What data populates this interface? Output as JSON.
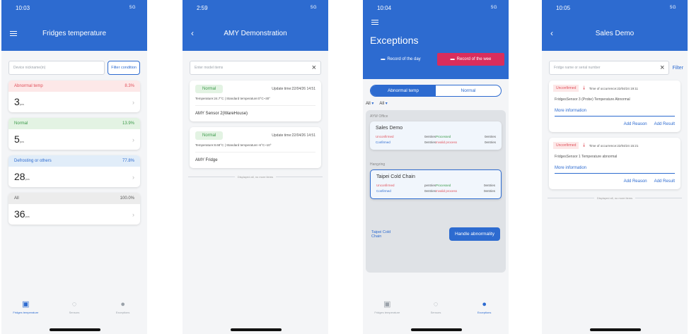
{
  "colors": {
    "primary": "#2d6bd0",
    "abnormal": "#fde8e8",
    "normal": "#e3f3e3",
    "defrost": "#e1edf9",
    "all": "#ececec"
  },
  "screen1": {
    "time": "10:03",
    "signal": "5G",
    "title": "Fridges temperature",
    "search_placeholder": "Device nickname(in)",
    "filter_button": "Filter condition",
    "stats": [
      {
        "label": "Abnormal temp",
        "pct": "8.3%",
        "count": "3",
        "unit": "pcs"
      },
      {
        "label": "Normal",
        "pct": "13.9%",
        "count": "5",
        "unit": "pcs"
      },
      {
        "label": "Defrosting or others",
        "pct": "77.8%",
        "count": "28",
        "unit": "pcs"
      },
      {
        "label": "All",
        "pct": "100.0%",
        "count": "36",
        "unit": "pcs"
      }
    ],
    "tabs": [
      "Fridges temperature",
      "Sensors",
      "Exceptions"
    ]
  },
  "screen2": {
    "time": "2:59",
    "signal": "5G",
    "title": "AMY Demonstration",
    "search_placeholder": "Enter model items",
    "devices": [
      {
        "status": "Normal",
        "update": "Update time:22/04/26 14:51",
        "temp": "Temperature:24.7°C | Standard temperature:0°C~30°",
        "name": "AMY Sensor 2(WareHouse)"
      },
      {
        "status": "Normal",
        "update": "Update time:22/04/26 14:51",
        "temp": "Temperature:8.68°C | Standard temperature:-6°C~10°",
        "name": "AMY Fridge"
      }
    ],
    "end_text": "Displayed all, no more items"
  },
  "screen3": {
    "time": "10:04",
    "signal": "5G",
    "title": "Exceptions",
    "record_day": "Record of the day",
    "record_week": "Record of the wee",
    "seg_abnormal": "Abnormal temp",
    "seg_normal": "Normal",
    "filter_all_1": "All",
    "filter_all_2": "All",
    "groups": [
      {
        "group": "AYW Office",
        "name": "Sales Demo",
        "unconfirmed": "Unconfirmed",
        "uc_count": "0entries",
        "processed": "Processed",
        "p_count": "0entries",
        "confirmed": "Confirmed",
        "c_count": "0entries",
        "invalid": "Invalid process",
        "i_count": "0entries"
      },
      {
        "group": "Hangzing",
        "name": "Taipei Cold Chain",
        "unconfirmed": "Unconfirmed",
        "uc_count": "pentries",
        "processed": "Processed",
        "p_count": "0entries",
        "confirmed": "Confirmed",
        "c_count": "0entries",
        "invalid": "Invalid process",
        "i_count": "0entries"
      }
    ],
    "bottom_label": "Taipei Cold Chain",
    "handle_button": "Handle abnormality",
    "tabs": [
      "Fridges temperature",
      "Sensors",
      "Exceptions"
    ]
  },
  "screen4": {
    "time": "10:05",
    "signal": "5G",
    "title": "Sales Demo",
    "search_placeholder": "Fridge name or serial number",
    "filter": "Filter",
    "records": [
      {
        "status": "Unconfirmed",
        "time": "Time of occurrence:22/04/24 19:11",
        "desc": "FridgesSensor 3 (Probe) Temperature Abnormal",
        "more": "More information",
        "add_reason": "Add Reason",
        "add_result": "Add Result"
      },
      {
        "status": "Unconfirmed",
        "time": "Time of occurrence:22/04/24 15:21",
        "desc": "FridgesSensor 1 Temperature abnormal",
        "more": "More information",
        "add_reason": "Add Reason",
        "add_result": "Add Result"
      }
    ],
    "end_text": "Displayed all, no more items"
  }
}
